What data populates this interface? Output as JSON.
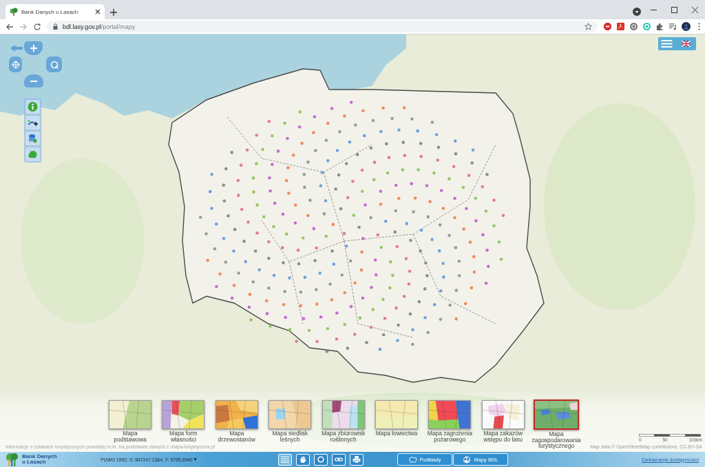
{
  "browser": {
    "tab_title": "Bank Danych o Lasach",
    "url": {
      "domain": "bdl.lasy.gov.pl",
      "path": "/portal/mapy"
    }
  },
  "map_types": [
    {
      "label": "Mapa\npodstawowa",
      "selected": false
    },
    {
      "label": "Mapa form\nwłasności",
      "selected": false
    },
    {
      "label": "Mapa\ndrzewostanów",
      "selected": false
    },
    {
      "label": "Mapa siedlisk\nleśnych",
      "selected": false
    },
    {
      "label": "Mapa zbiorowisk\nroślinnych",
      "selected": false
    },
    {
      "label": "Mapa łowiectwa",
      "selected": false
    },
    {
      "label": "Mapa zagrożenia\npożarowego",
      "selected": false
    },
    {
      "label": "Mapa zakazów\nwstępu do lasu",
      "selected": false
    },
    {
      "label": "Mapa\nzagospodarowania\nturystycznego",
      "selected": true
    }
  ],
  "attribution": {
    "trails_note": "Informacje o szlakach turystycznych powstały m.in. na podstawie danych z mapa-turystyczna.pl",
    "map_data": "Map data © OpenStreetMap contributors, CC-BY-SA"
  },
  "scale_bar": {
    "labels": [
      "0",
      "50",
      "100km"
    ]
  },
  "footer": {
    "logo_text": "Bank Danych\no Lasach",
    "coordinates": "PUWG 1992: X: 847247.1364, Y: 5795.6940",
    "tools": [
      {
        "kind": "legend",
        "selected": true
      },
      {
        "kind": "tools",
        "selected": false
      },
      {
        "kind": "globe",
        "selected": false
      },
      {
        "kind": "link",
        "selected": false
      },
      {
        "kind": "print",
        "selected": false
      }
    ],
    "buttons": [
      {
        "kind": "basemaps",
        "label": "Podkłady"
      },
      {
        "kind": "bdl_maps",
        "label": "Mapy BDL"
      }
    ],
    "accessibility_link": "Deklaracja dostępności"
  }
}
